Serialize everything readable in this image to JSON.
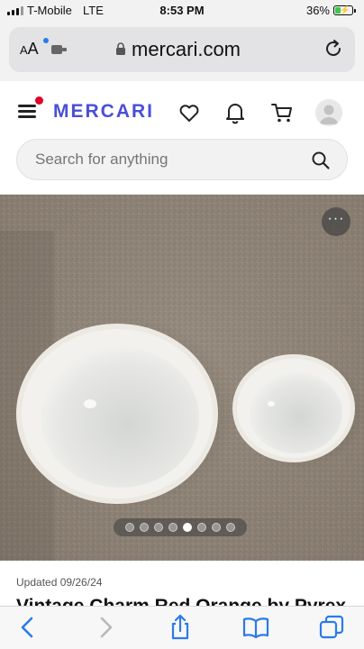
{
  "status_bar": {
    "carrier": "T-Mobile",
    "network": "LTE",
    "time": "8:53 PM",
    "battery_percent": "36%",
    "battery_level": 0.36,
    "battery_color": "#3cc84a"
  },
  "browser": {
    "text_size_label": "AA",
    "url": "mercari.com",
    "toolbar_icons": [
      "back-icon",
      "forward-icon",
      "share-icon",
      "bookmarks-icon",
      "tabs-icon"
    ]
  },
  "site": {
    "logo": "MERCARI",
    "brand_color": "#4a4fd6",
    "notification_dot_color": "#e0002a",
    "header_icons": [
      "heart-icon",
      "bell-icon",
      "cart-icon",
      "avatar-icon"
    ],
    "search_placeholder": "Search for anything"
  },
  "product": {
    "image_count": 8,
    "active_image_index": 4,
    "updated": "Updated 09/26/24",
    "title": "Vintage Charm Red Orange by Pyrex"
  }
}
